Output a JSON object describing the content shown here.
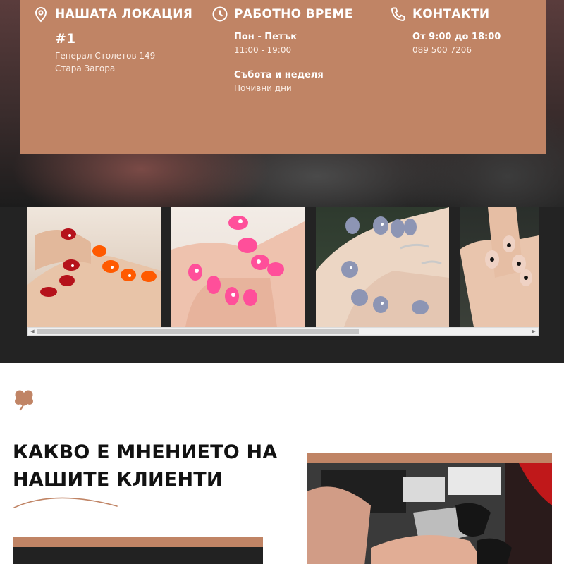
{
  "info": {
    "location": {
      "title": "НАШАТА ЛОКАЦИЯ",
      "number": "#1",
      "address_line1": "Генерал Столетов 149",
      "address_line2": "Стара Загора",
      "icon": "map-pin-icon"
    },
    "hours": {
      "title": "РАБОТНО ВРЕМЕ",
      "weekdays_label": "Пон - Петък",
      "weekdays_value": "11:00 - 19:00",
      "weekend_label": "Събота и неделя",
      "weekend_value": "Почивни дни",
      "icon": "clock-icon"
    },
    "contacts": {
      "title": "КОНТАКТИ",
      "hours_label": "От 9:00 до 18:00",
      "phone": "089 500 7206",
      "icon": "phone-icon"
    }
  },
  "gallery": {
    "images": [
      "nails-red-orange",
      "nails-pink-ombre",
      "nails-silver-glitter",
      "nails-nude-flowers"
    ],
    "scrollbar": {
      "left_arrow": "◀",
      "right_arrow": "▶"
    }
  },
  "testimonials": {
    "title": "КАКВО Е МНЕНИЕТО НА НАШИТЕ КЛИЕНТИ",
    "decor_icon": "clover-icon"
  },
  "colors": {
    "accent": "#c08465",
    "dark": "#232323",
    "text_dark": "#121212"
  }
}
